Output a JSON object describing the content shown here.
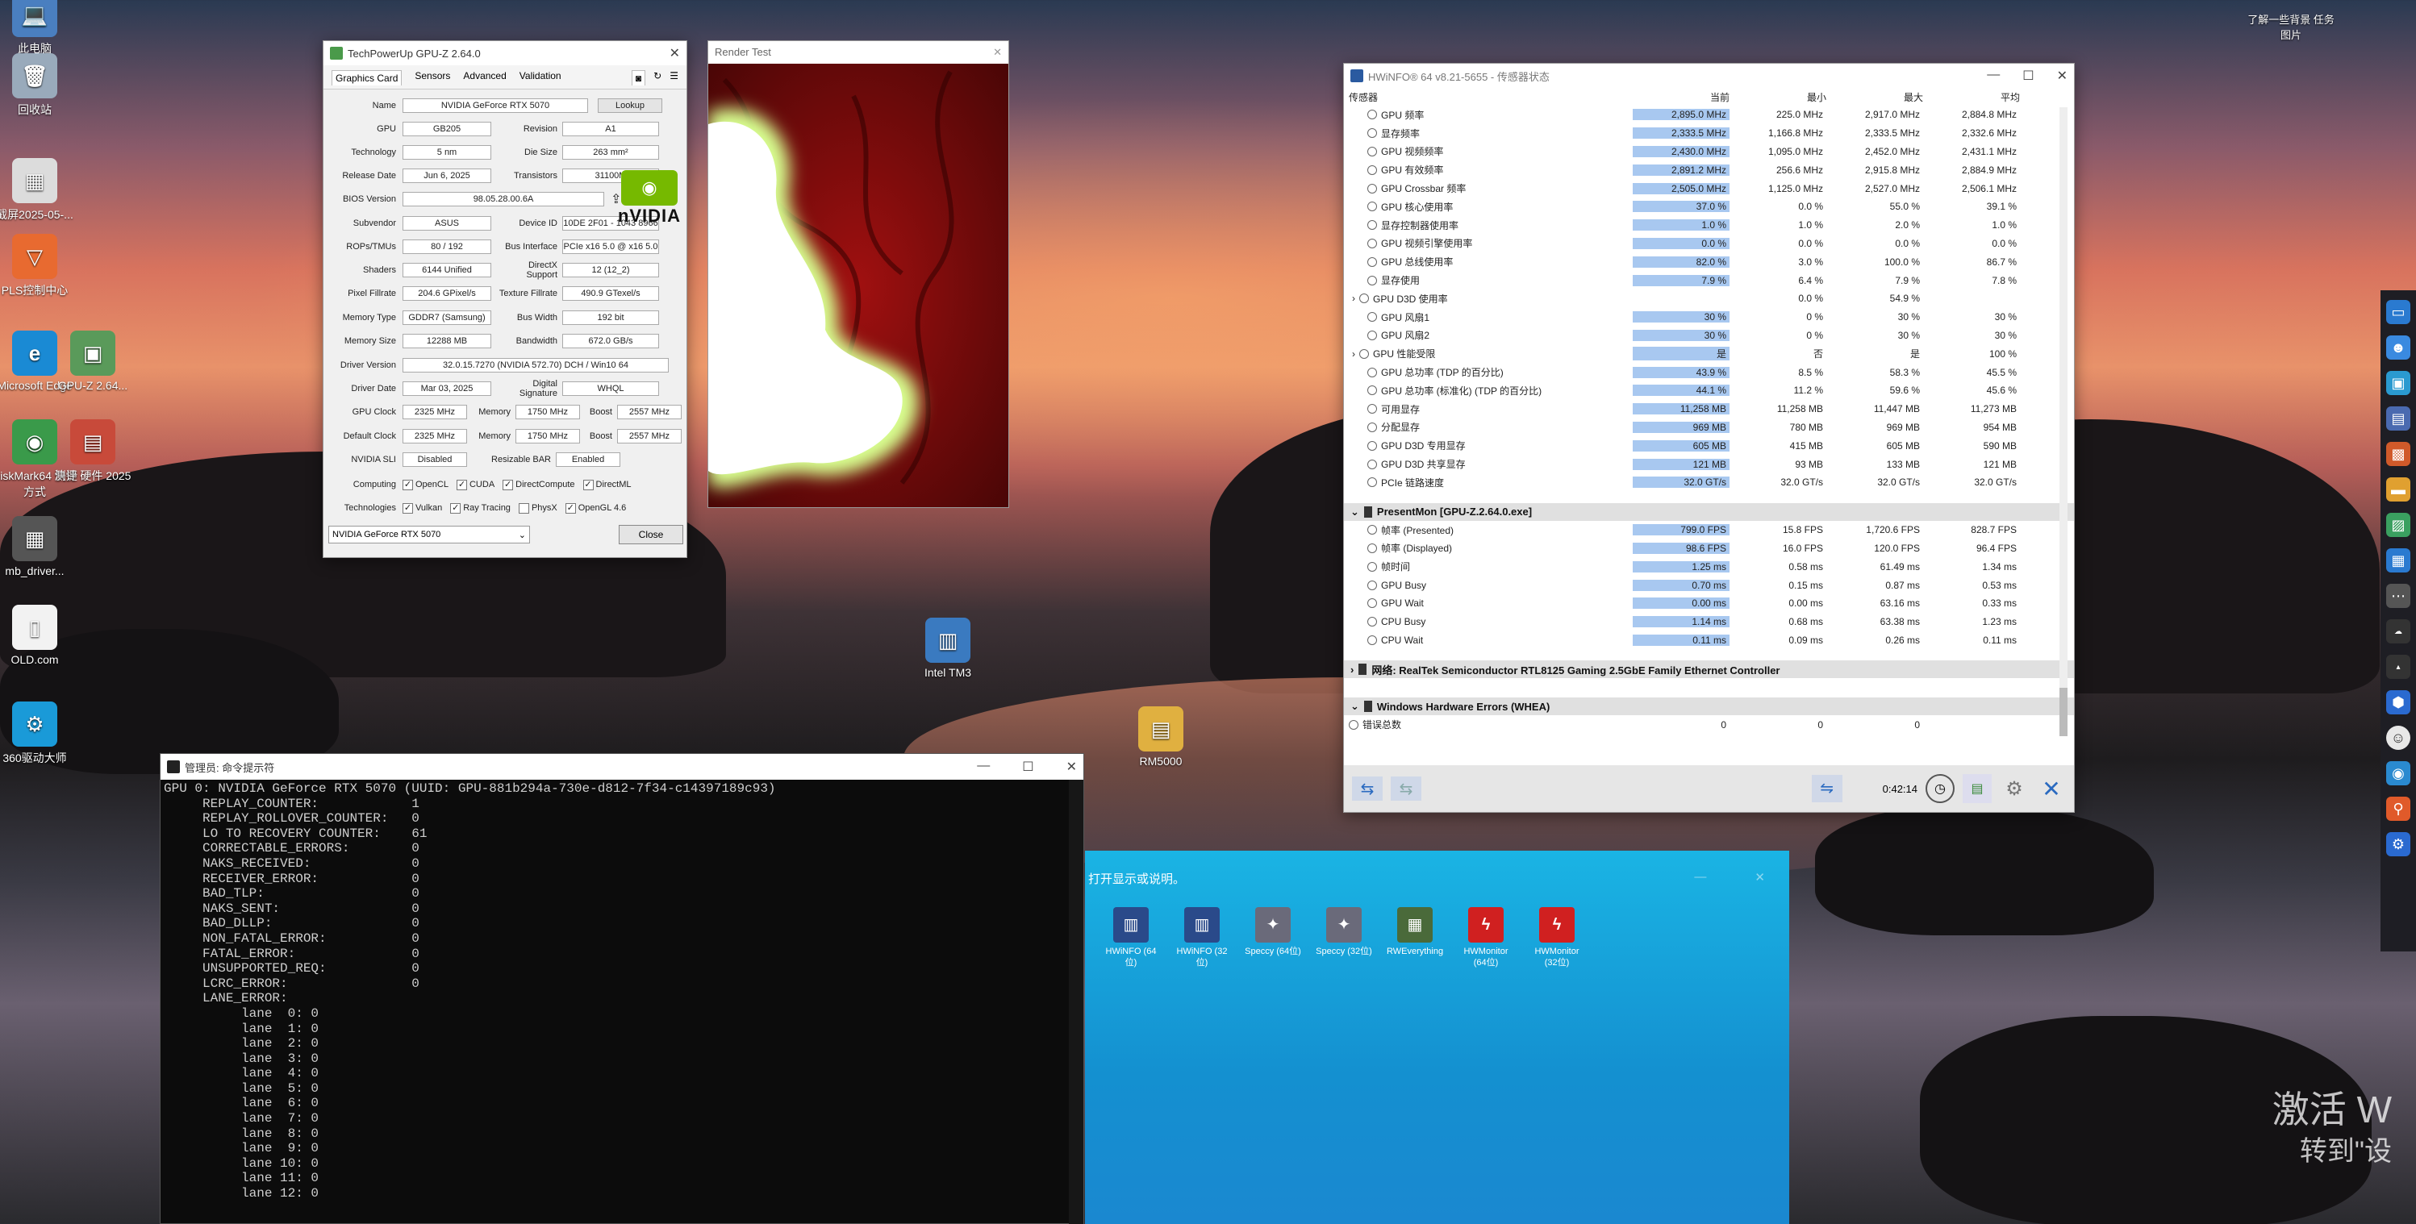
{
  "desktop": {
    "icons": [
      {
        "label": "此电脑",
        "glyph": "💻",
        "color": "#4a7fc0"
      },
      {
        "label": "回收站",
        "glyph": "🗑",
        "color": "#9ab"
      },
      {
        "label": "截屏2025-05-...",
        "glyph": "▦",
        "color": "#dcdcdc"
      },
      {
        "label": "PLS控制中心",
        "glyph": "▽",
        "color": "#e86a30"
      },
      {
        "label": "Microsoft Edge",
        "glyph": "e",
        "color": "#1a8ad4"
      },
      {
        "label": "GPU-Z 2.64...",
        "glyph": "▣",
        "color": "#5a9a5a"
      },
      {
        "label": "DiskMark64 快捷方式",
        "glyph": "◉",
        "color": "#3a9a4a"
      },
      {
        "label": "测评 硬件 2025",
        "glyph": "▤",
        "color": "#c84a3a"
      },
      {
        "label": "mb_driver...",
        "glyph": "▦",
        "color": "#555"
      },
      {
        "label": "OLD.com",
        "glyph": "▯",
        "color": "#f2f2f2"
      },
      {
        "label": "360驱动大师",
        "glyph": "⚙",
        "color": "#1a9ad8"
      }
    ],
    "mid_icons": [
      {
        "label": "Intel TM3",
        "glyph": "▥",
        "color": "#3a7ac0"
      },
      {
        "label": "RM5000",
        "glyph": "▤",
        "color": "#e0b040"
      }
    ],
    "top_right": "了解一些背景 任务图片",
    "watermark_line1": "激活 W",
    "watermark_line2": "转到\"设"
  },
  "gpuz": {
    "title": "TechPowerUp GPU-Z 2.64.0",
    "tabs": [
      "Graphics Card",
      "Sensors",
      "Advanced",
      "Validation"
    ],
    "lookup": "Lookup",
    "logo_text": "nVIDIA",
    "uefi": "UEFI",
    "rows": [
      {
        "label": "Name",
        "value": "NVIDIA GeForce RTX 5070"
      },
      {
        "label": "GPU",
        "value": "GB205",
        "sublabel": "Revision",
        "subvalue": "A1"
      },
      {
        "label": "Technology",
        "value": "5 nm",
        "sublabel": "Die Size",
        "subvalue": "263 mm²"
      },
      {
        "label": "Release Date",
        "value": "Jun 6, 2025",
        "sublabel": "Transistors",
        "subvalue": "31100M"
      },
      {
        "label": "BIOS Version",
        "value": "98.05.28.00.6A"
      },
      {
        "label": "Subvendor",
        "value": "ASUS",
        "sublabel": "Device ID",
        "subvalue": "10DE 2F01 - 1043 8966"
      },
      {
        "label": "ROPs/TMUs",
        "value": "80 / 192",
        "sublabel": "Bus Interface",
        "subvalue": "PCIe x16 5.0 @ x16 5.0"
      },
      {
        "label": "Shaders",
        "value": "6144 Unified",
        "sublabel": "DirectX Support",
        "subvalue": "12 (12_2)"
      },
      {
        "label": "Pixel Fillrate",
        "value": "204.6 GPixel/s",
        "sublabel": "Texture Fillrate",
        "subvalue": "490.9 GTexel/s"
      },
      {
        "label": "Memory Type",
        "value": "GDDR7 (Samsung)",
        "sublabel": "Bus Width",
        "subvalue": "192 bit"
      },
      {
        "label": "Memory Size",
        "value": "12288 MB",
        "sublabel": "Bandwidth",
        "subvalue": "672.0 GB/s"
      },
      {
        "label": "Driver Version",
        "value": "32.0.15.7270 (NVIDIA 572.70) DCH / Win10 64"
      },
      {
        "label": "Driver Date",
        "value": "Mar 03, 2025",
        "sublabel": "Digital Signature",
        "subvalue": "WHQL"
      }
    ],
    "clock_rows": [
      {
        "label": "GPU Clock",
        "a": "2325 MHz",
        "mlabel": "Memory",
        "b": "1750 MHz",
        "blabel": "Boost",
        "c": "2557 MHz"
      },
      {
        "label": "Default Clock",
        "a": "2325 MHz",
        "mlabel": "Memory",
        "b": "1750 MHz",
        "blabel": "Boost",
        "c": "2557 MHz"
      },
      {
        "label": "NVIDIA SLI",
        "a": "Disabled",
        "mlabel": "Resizable BAR",
        "b": "",
        "blabel": "",
        "c": "Enabled"
      }
    ],
    "computing_label": "Computing",
    "computing": [
      "OpenCL",
      "CUDA",
      "DirectCompute",
      "DirectML"
    ],
    "tech_label": "Technologies",
    "technologies": [
      "Vulkan",
      "Ray Tracing",
      "PhysX",
      "OpenGL 4.6"
    ],
    "selected_gpu": "NVIDIA GeForce RTX 5070",
    "close": "Close"
  },
  "render": {
    "title": "Render Test"
  },
  "hwinfo": {
    "title": "HWiNFO® 64 v8.21-5655 - 传感器状态",
    "headers": [
      "传感器",
      "当前",
      "最小",
      "最大",
      "平均"
    ],
    "rows": [
      {
        "name": "GPU 频率",
        "cur": "2,895.0 MHz",
        "min": "225.0 MHz",
        "max": "2,917.0 MHz",
        "avg": "2,884.8 MHz"
      },
      {
        "name": "显存频率",
        "cur": "2,333.5 MHz",
        "min": "1,166.8 MHz",
        "max": "2,333.5 MHz",
        "avg": "2,332.6 MHz"
      },
      {
        "name": "GPU 视频频率",
        "cur": "2,430.0 MHz",
        "min": "1,095.0 MHz",
        "max": "2,452.0 MHz",
        "avg": "2,431.1 MHz"
      },
      {
        "name": "GPU 有效频率",
        "cur": "2,891.2 MHz",
        "min": "256.6 MHz",
        "max": "2,915.8 MHz",
        "avg": "2,884.9 MHz"
      },
      {
        "name": "GPU Crossbar 频率",
        "cur": "2,505.0 MHz",
        "min": "1,125.0 MHz",
        "max": "2,527.0 MHz",
        "avg": "2,506.1 MHz"
      },
      {
        "name": "GPU 核心使用率",
        "cur": "37.0 %",
        "min": "0.0 %",
        "max": "55.0 %",
        "avg": "39.1 %"
      },
      {
        "name": "显存控制器使用率",
        "cur": "1.0 %",
        "min": "1.0 %",
        "max": "2.0 %",
        "avg": "1.0 %"
      },
      {
        "name": "GPU 视频引擎使用率",
        "cur": "0.0 %",
        "min": "0.0 %",
        "max": "0.0 %",
        "avg": "0.0 %"
      },
      {
        "name": "GPU 总线使用率",
        "cur": "82.0 %",
        "min": "3.0 %",
        "max": "100.0 %",
        "avg": "86.7 %"
      },
      {
        "name": "显存使用",
        "cur": "7.9 %",
        "min": "6.4 %",
        "max": "7.9 %",
        "avg": "7.8 %"
      },
      {
        "name": "GPU D3D 使用率",
        "cur": "",
        "min": "0.0 %",
        "max": "54.9 %",
        "avg": "",
        "expand": true
      },
      {
        "name": "GPU 风扇1",
        "cur": "30 %",
        "min": "0 %",
        "max": "30 %",
        "avg": "30 %"
      },
      {
        "name": "GPU 风扇2",
        "cur": "30 %",
        "min": "0 %",
        "max": "30 %",
        "avg": "30 %"
      },
      {
        "name": "GPU 性能受限",
        "cur": "是",
        "min": "否",
        "max": "是",
        "avg": "100 %",
        "expand": true
      },
      {
        "name": "GPU 总功率 (TDP 的百分比)",
        "cur": "43.9 %",
        "min": "8.5 %",
        "max": "58.3 %",
        "avg": "45.5 %"
      },
      {
        "name": "GPU 总功率 (标准化) (TDP 的百分比)",
        "cur": "44.1 %",
        "min": "11.2 %",
        "max": "59.6 %",
        "avg": "45.6 %"
      },
      {
        "name": "可用显存",
        "cur": "11,258 MB",
        "min": "11,258 MB",
        "max": "11,447 MB",
        "avg": "11,273 MB"
      },
      {
        "name": "分配显存",
        "cur": "969 MB",
        "min": "780 MB",
        "max": "969 MB",
        "avg": "954 MB"
      },
      {
        "name": "GPU D3D 专用显存",
        "cur": "605 MB",
        "min": "415 MB",
        "max": "605 MB",
        "avg": "590 MB"
      },
      {
        "name": "GPU D3D 共享显存",
        "cur": "121 MB",
        "min": "93 MB",
        "max": "133 MB",
        "avg": "121 MB"
      },
      {
        "name": "PCIe 链路速度",
        "cur": "32.0 GT/s",
        "min": "32.0 GT/s",
        "max": "32.0 GT/s",
        "avg": "32.0 GT/s"
      }
    ],
    "section_presentmon": "PresentMon [GPU-Z.2.64.0.exe]",
    "pm_rows": [
      {
        "name": "帧率 (Presented)",
        "cur": "799.0 FPS",
        "min": "15.8 FPS",
        "max": "1,720.6 FPS",
        "avg": "828.7 FPS"
      },
      {
        "name": "帧率 (Displayed)",
        "cur": "98.6 FPS",
        "min": "16.0 FPS",
        "max": "120.0 FPS",
        "avg": "96.4 FPS"
      },
      {
        "name": "帧时间",
        "cur": "1.25 ms",
        "min": "0.58 ms",
        "max": "61.49 ms",
        "avg": "1.34 ms"
      },
      {
        "name": "GPU Busy",
        "cur": "0.70 ms",
        "min": "0.15 ms",
        "max": "0.87 ms",
        "avg": "0.53 ms"
      },
      {
        "name": "GPU Wait",
        "cur": "0.00 ms",
        "min": "0.00 ms",
        "max": "63.16 ms",
        "avg": "0.33 ms"
      },
      {
        "name": "CPU Busy",
        "cur": "1.14 ms",
        "min": "0.68 ms",
        "max": "63.38 ms",
        "avg": "1.23 ms"
      },
      {
        "name": "CPU Wait",
        "cur": "0.11 ms",
        "min": "0.09 ms",
        "max": "0.26 ms",
        "avg": "0.11 ms"
      }
    ],
    "section_net": "网络: RealTek Semiconductor RTL8125 Gaming 2.5GbE Family Ethernet Controller",
    "section_whea": "Windows Hardware Errors (WHEA)",
    "whea_row": {
      "name": "错误总数",
      "cur": "0",
      "min": "0",
      "max": "0",
      "avg": ""
    },
    "elapsed": "0:42:14"
  },
  "cmd": {
    "title": "管理员: 命令提示符",
    "lines": [
      "GPU 0: NVIDIA GeForce RTX 5070 (UUID: GPU-881b294a-730e-d812-7f34-c14397189c93)",
      "     REPLAY_COUNTER:            1",
      "     REPLAY_ROLLOVER_COUNTER:   0",
      "     LO TO RECOVERY COUNTER:    61",
      "     CORRECTABLE_ERRORS:        0",
      "     NAKS_RECEIVED:             0",
      "     RECEIVER_ERROR:            0",
      "     BAD_TLP:                   0",
      "     NAKS_SENT:                 0",
      "     BAD_DLLP:                  0",
      "     NON_FATAL_ERROR:           0",
      "     FATAL_ERROR:               0",
      "     UNSUPPORTED_REQ:           0",
      "     LCRC_ERROR:                0",
      "     LANE_ERROR:",
      "          lane  0: 0",
      "          lane  1: 0",
      "          lane  2: 0",
      "          lane  3: 0",
      "          lane  4: 0",
      "          lane  5: 0",
      "          lane  6: 0",
      "          lane  7: 0",
      "          lane  8: 0",
      "          lane  9: 0",
      "          lane 10: 0",
      "          lane 11: 0",
      "          lane 12: 0"
    ]
  },
  "folder": {
    "title": "打开显示或说明。",
    "apps": [
      {
        "label": "HWiNFO (64位)",
        "glyph": "▥",
        "color": "#2a4a8a"
      },
      {
        "label": "HWiNFO (32位)",
        "glyph": "▥",
        "color": "#2a4a8a"
      },
      {
        "label": "Speccy (64位)",
        "glyph": "✦",
        "color": "#6a6a7a"
      },
      {
        "label": "Speccy (32位)",
        "glyph": "✦",
        "color": "#6a6a7a"
      },
      {
        "label": "RWEverything",
        "glyph": "▦",
        "color": "#4a6a3a"
      },
      {
        "label": "HWMonitor (64位)",
        "glyph": "ϟ",
        "color": "#d02020"
      },
      {
        "label": "HWMonitor (32位)",
        "glyph": "ϟ",
        "color": "#d02020"
      }
    ]
  }
}
